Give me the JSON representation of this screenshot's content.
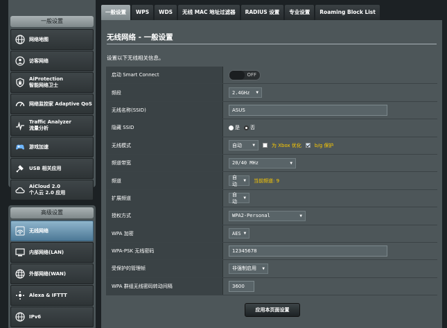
{
  "sidebar": {
    "general_header": "一般设置",
    "general_items": [
      {
        "label": "网络地图",
        "icon": "globe-icon"
      },
      {
        "label": "访客网络",
        "icon": "guest-network-icon"
      },
      {
        "label": "AiProtection\n智能网络卫士",
        "icon": "shield-lock-icon"
      },
      {
        "label": "网络监控家 Adaptive QoS",
        "icon": "speedometer-icon"
      },
      {
        "label": "Traffic Analyzer\n流量分析",
        "icon": "traffic-analyzer-icon"
      },
      {
        "label": "游戏加速",
        "icon": "gamepad-icon"
      },
      {
        "label": "USB 相关应用",
        "icon": "usb-icon"
      },
      {
        "label": "AiCloud 2.0\n个人云 2.0 应用",
        "icon": "cloud-icon"
      }
    ],
    "advanced_header": "高级设置",
    "advanced_items": [
      {
        "label": "无线网络",
        "icon": "wifi-icon",
        "active": true
      },
      {
        "label": "内部网络(LAN)",
        "icon": "lan-icon"
      },
      {
        "label": "外部网络(WAN)",
        "icon": "wan-globe-icon"
      },
      {
        "label": "Alexa & IFTTT",
        "icon": "alexa-icon"
      },
      {
        "label": "IPv6",
        "icon": "ipv6-icon"
      }
    ]
  },
  "tabs": [
    "一般设置",
    "WPS",
    "WDS",
    "无线 MAC 地址过滤器",
    "RADIUS 设置",
    "专业设置",
    "Roaming Block List"
  ],
  "active_tab": 0,
  "page": {
    "title": "无线网络 - 一般设置",
    "description": "设置以下无线相关信息。",
    "apply_label": "应用本页面设置"
  },
  "form": {
    "smart_connect": {
      "label": "启动 Smart Connect",
      "state": "OFF"
    },
    "band": {
      "label": "频段",
      "value": "2.4GHz"
    },
    "ssid": {
      "label": "无线名称(SSID)",
      "value": "ASUS"
    },
    "hide_ssid": {
      "label": "隐藏 SSID",
      "yes": "是",
      "no": "否",
      "selected": "否"
    },
    "wireless_mode": {
      "label": "无线模式",
      "value": "自动",
      "xbox_label": "为 Xbox 优化",
      "xbox_checked": false,
      "bg_label": "b/g 保护",
      "bg_checked": true
    },
    "bandwidth": {
      "label": "频道带宽",
      "value": "20/40 MHz"
    },
    "channel": {
      "label": "频道",
      "value": "自动",
      "current": "当前频道: 9"
    },
    "ext_channel": {
      "label": "扩展频道",
      "value": "自动"
    },
    "auth_method": {
      "label": "授权方式",
      "value": "WPA2-Personal"
    },
    "wpa_encryption": {
      "label": "WPA 加密",
      "value": "AES"
    },
    "wpa_psk": {
      "label": "WPA-PSK 无线密码",
      "value": "12345678"
    },
    "pmf": {
      "label": "受保护的管理帧",
      "value": "非强制启用"
    },
    "group_key": {
      "label": "WPA 群组无线密码转动间隔",
      "value": "3600"
    }
  }
}
